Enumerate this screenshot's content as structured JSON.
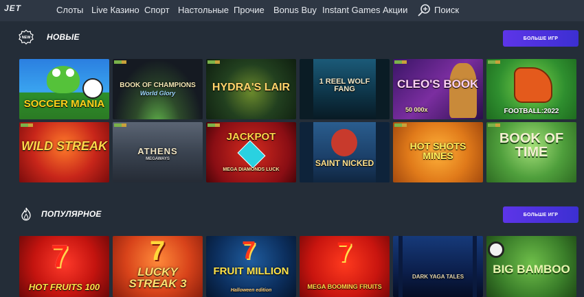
{
  "brand": {
    "logo_text": "JET"
  },
  "nav": {
    "items": [
      "Слоты",
      "Live Казино",
      "Спорт",
      "Настольные",
      "Прочие",
      "Bonus Buy",
      "Instant Games",
      "Акции"
    ],
    "search_label": "Поиск"
  },
  "sections": [
    {
      "title": "НОВЫЕ",
      "badge_icon": "new-badge-icon",
      "badge_text": "NEW",
      "more_label": "БОЛЬШЕ ИГР",
      "games": [
        {
          "title": "SOCCER MANIA",
          "bg": "#2f7ed8"
        },
        {
          "title": "BOOK OF CHAMPIONS",
          "subtitle": "World Glory",
          "bg": "#1d2430"
        },
        {
          "title": "HYDRA'S LAIR",
          "bg": "#1f3b24"
        },
        {
          "title": "1 REEL WOLF FANG",
          "bg": "#0f2d3c"
        },
        {
          "title": "CLEO'S BOOK",
          "subtitle": "50 000x",
          "bg": "#5a1e78"
        },
        {
          "title": "FOOTBALL:2022",
          "bg": "#2f8f2f"
        },
        {
          "title": "WILD STREAK",
          "bg": "#b01a14"
        },
        {
          "title": "ATHENS",
          "subtitle": "MEGAWAYS",
          "bg": "#3b4454"
        },
        {
          "title": "JACKPOT",
          "subtitle": "MEGA DIAMONDS LUCK",
          "bg": "#8a0e14"
        },
        {
          "title": "SAINT NICKED",
          "bg": "#1b3f68"
        },
        {
          "title": "HOT SHOTS MINES",
          "bg": "#e07a1a"
        },
        {
          "title": "BOOK OF TIME",
          "bg": "#3e8f34"
        }
      ]
    },
    {
      "title": "ПОПУЛЯРНОЕ",
      "badge_icon": "flame-icon",
      "more_label": "БОЛЬШЕ ИГР",
      "games": [
        {
          "title": "HOT FRUITS 100",
          "bg": "#c4140f"
        },
        {
          "title": "LUCKY STREAK 3",
          "bg": "#d8431a"
        },
        {
          "title": "FRUIT MILLION",
          "subtitle": "Halloween edition",
          "bg": "#0c2f5e"
        },
        {
          "title": "MEGA BOOMING FRUITS",
          "bg": "#c9150f"
        },
        {
          "title": "DARK YAGA TALES",
          "bg": "#0b1e4a"
        },
        {
          "title": "BIG BAMBOO",
          "bg": "#3b7f2a"
        }
      ]
    }
  ],
  "colors": {
    "page_bg": "#242d38",
    "nav_bg": "#2e3744",
    "accent": "#4a30dd",
    "new_flag_green": "#7ab24a",
    "new_flag_gold": "#c9a13a"
  }
}
